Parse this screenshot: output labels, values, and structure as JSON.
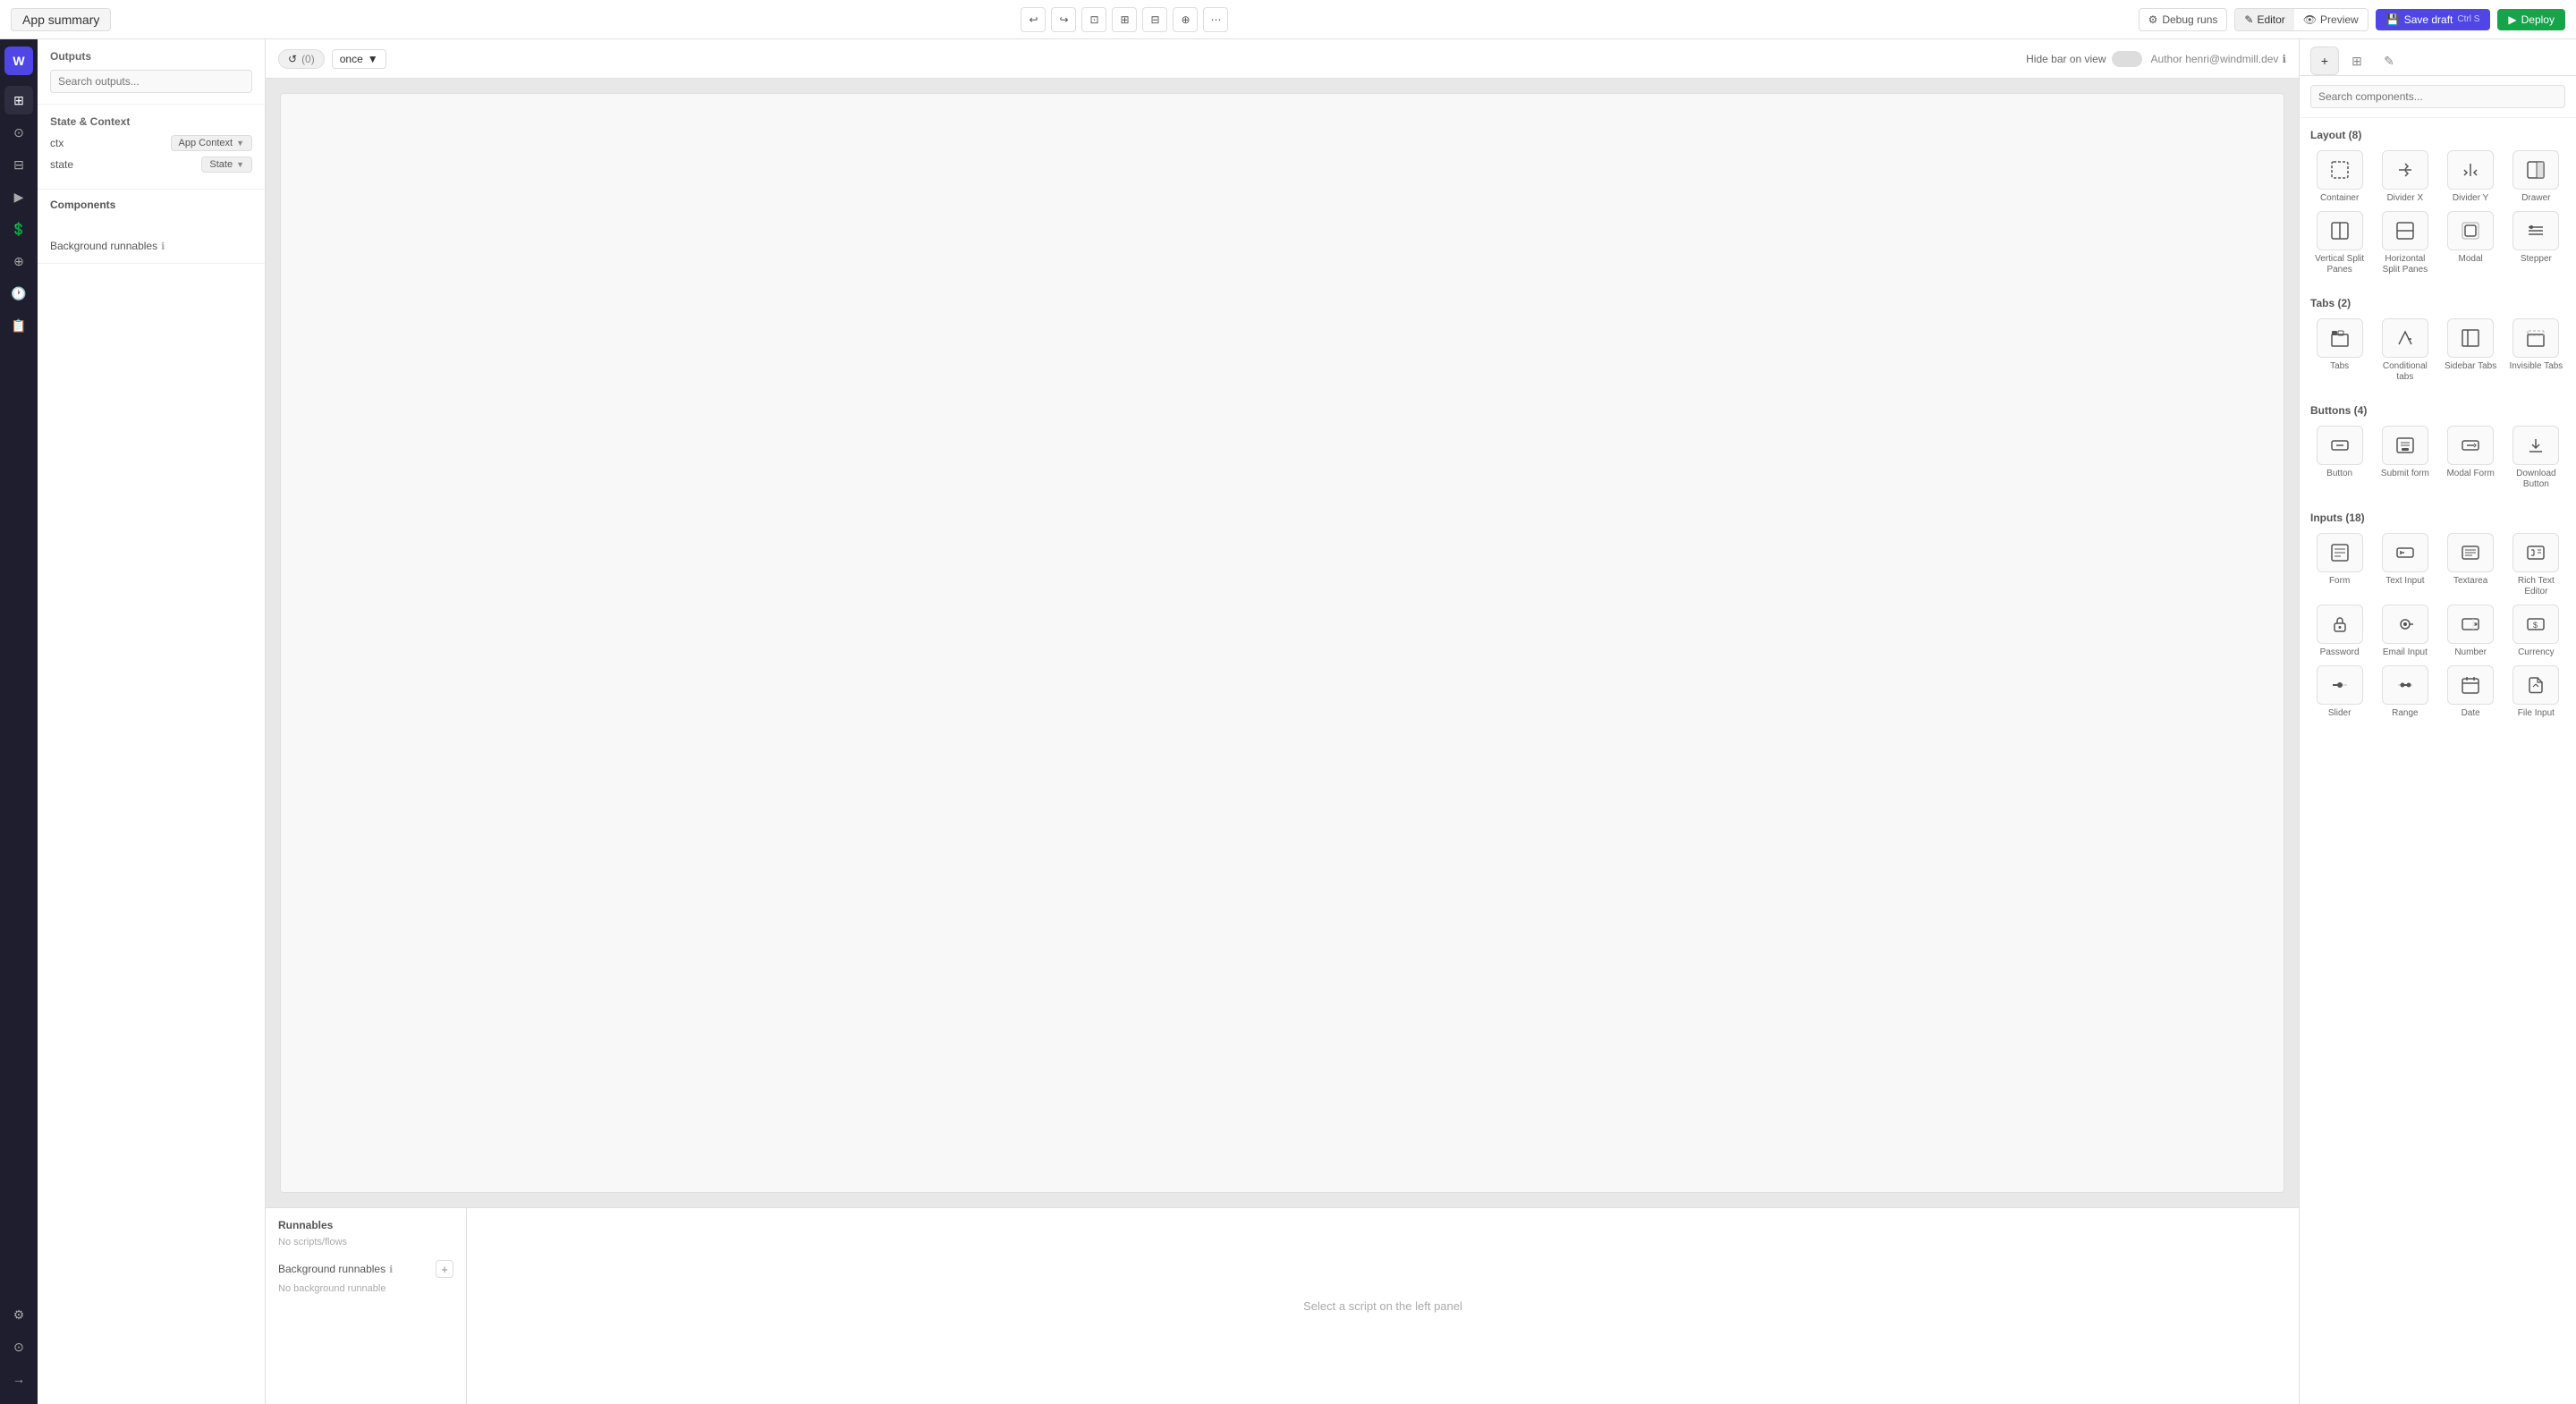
{
  "topbar": {
    "app_title": "App summary",
    "undo_label": "Undo",
    "redo_label": "Redo",
    "fit_label": "Fit",
    "debug_label": "Debug runs",
    "editor_label": "Editor",
    "preview_label": "Preview",
    "save_label": "Save draft",
    "save_shortcut": "Ctrl S",
    "deploy_label": "Deploy"
  },
  "sidebar": {
    "outputs_title": "Outputs",
    "search_placeholder": "Search outputs...",
    "state_context_title": "State & Context",
    "ctx_key": "ctx",
    "ctx_value": "App Context",
    "state_key": "state",
    "state_value": "State",
    "components_title": "Components",
    "bg_runnables_title": "Background runnables"
  },
  "canvas": {
    "run_count": "(0)",
    "run_frequency": "once",
    "hide_bar_label": "Hide bar on view",
    "author_label": "Author henri@windmill.dev"
  },
  "runnables": {
    "title": "Runnables",
    "no_scripts": "No scripts/flows",
    "bg_title": "Background runnables",
    "bg_empty": "No background runnable",
    "select_script": "Select a script on the left panel"
  },
  "components_panel": {
    "search_placeholder": "Search components...",
    "layout_section": "Layout (8)",
    "tabs_section": "Tabs (2)",
    "buttons_section": "Buttons (4)",
    "inputs_section": "Inputs (18)",
    "layout_items": [
      {
        "id": "container",
        "label": "Container",
        "icon": "⬜"
      },
      {
        "id": "divider-x",
        "label": "Divider X",
        "icon": "⟺"
      },
      {
        "id": "divider-y",
        "label": "Divider Y",
        "icon": "⟹"
      },
      {
        "id": "drawer",
        "label": "Drawer",
        "icon": "▣"
      },
      {
        "id": "vertical-split",
        "label": "Vertical Split Panes",
        "icon": "⊞"
      },
      {
        "id": "horizontal-split",
        "label": "Horizontal Split Panes",
        "icon": "⊟"
      },
      {
        "id": "modal",
        "label": "Modal",
        "icon": "⧉"
      },
      {
        "id": "stepper",
        "label": "Stepper",
        "icon": "≡"
      }
    ],
    "tabs_items": [
      {
        "id": "tabs",
        "label": "Tabs",
        "icon": "≡"
      },
      {
        "id": "conditional-tabs",
        "label": "Conditional tabs",
        "icon": "⇗"
      },
      {
        "id": "sidebar-tabs",
        "label": "Sidebar Tabs",
        "icon": "▤"
      },
      {
        "id": "invisible-tabs",
        "label": "Invisible Tabs",
        "icon": "▭"
      }
    ],
    "buttons_items": [
      {
        "id": "button",
        "label": "Button",
        "icon": "⊡"
      },
      {
        "id": "submit-form",
        "label": "Submit form",
        "icon": "⊟"
      },
      {
        "id": "modal-form",
        "label": "Modal Form",
        "icon": "⊞"
      },
      {
        "id": "download-button",
        "label": "Download Button",
        "icon": "⬇"
      }
    ],
    "inputs_items": [
      {
        "id": "form",
        "label": "Form",
        "icon": "📄"
      },
      {
        "id": "text-input",
        "label": "Text Input",
        "icon": "⌨"
      },
      {
        "id": "textarea",
        "label": "Textarea",
        "icon": "⌨"
      },
      {
        "id": "rich-text",
        "label": "Rich Text Editor",
        "icon": "⌨"
      },
      {
        "id": "password",
        "label": "Password",
        "icon": "🔒"
      },
      {
        "id": "email-input",
        "label": "Email Input",
        "icon": "@"
      },
      {
        "id": "number",
        "label": "Number",
        "icon": "#"
      },
      {
        "id": "currency",
        "label": "Currency",
        "icon": "$"
      },
      {
        "id": "slider",
        "label": "Slider",
        "icon": "⊟"
      },
      {
        "id": "range",
        "label": "Range",
        "icon": "⊟"
      },
      {
        "id": "date",
        "label": "Date",
        "icon": "📅"
      },
      {
        "id": "file-input",
        "label": "File Input",
        "icon": "📎"
      }
    ]
  },
  "nav_items": [
    {
      "id": "home",
      "icon": "⊞",
      "label": "Home"
    },
    {
      "id": "search",
      "icon": "⊙",
      "label": "Search"
    },
    {
      "id": "apps",
      "icon": "⊟",
      "label": "Apps"
    },
    {
      "id": "flows",
      "icon": "▶",
      "label": "Flows"
    },
    {
      "id": "resources",
      "icon": "💲",
      "label": "Resources"
    },
    {
      "id": "variables",
      "icon": "⊕",
      "label": "Variables"
    }
  ]
}
